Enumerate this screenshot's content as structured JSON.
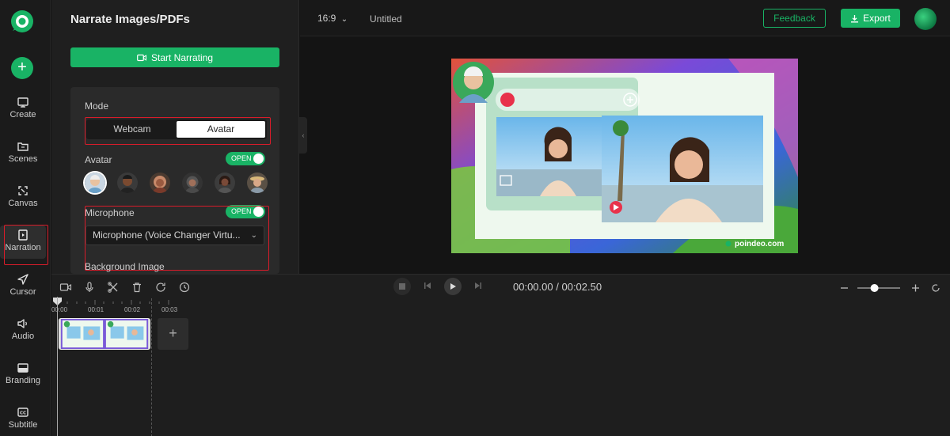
{
  "sidebar": {
    "items": [
      {
        "label": "Create"
      },
      {
        "label": "Scenes"
      },
      {
        "label": "Canvas"
      },
      {
        "label": "Narration"
      },
      {
        "label": "Cursor"
      },
      {
        "label": "Audio"
      },
      {
        "label": "Branding"
      },
      {
        "label": "Subtitle"
      }
    ],
    "active": "Narration"
  },
  "panel": {
    "title": "Narrate Images/PDFs",
    "start_label": "Start Narrating",
    "mode_label": "Mode",
    "mode_options": [
      "Webcam",
      "Avatar"
    ],
    "mode_selected": "Avatar",
    "avatar_label": "Avatar",
    "avatar_toggle": "OPEN",
    "microphone_label": "Microphone",
    "microphone_toggle": "OPEN",
    "microphone_value": "Microphone (Voice Changer Virtu...",
    "background_label": "Background Image"
  },
  "topbar": {
    "ratio": "16:9",
    "project_title": "Untitled",
    "feedback_label": "Feedback",
    "export_label": "Export"
  },
  "preview": {
    "watermark": "poindeo.com"
  },
  "timeline": {
    "current_time": "00:00.00",
    "separator": "/",
    "total_time": "00:02.50",
    "ticks": [
      "00:00",
      "00:01",
      "00:02",
      "00:03"
    ],
    "zoom_level": 0.4
  },
  "colors": {
    "accent": "#19b365",
    "highlight_box": "#d91c2a"
  }
}
